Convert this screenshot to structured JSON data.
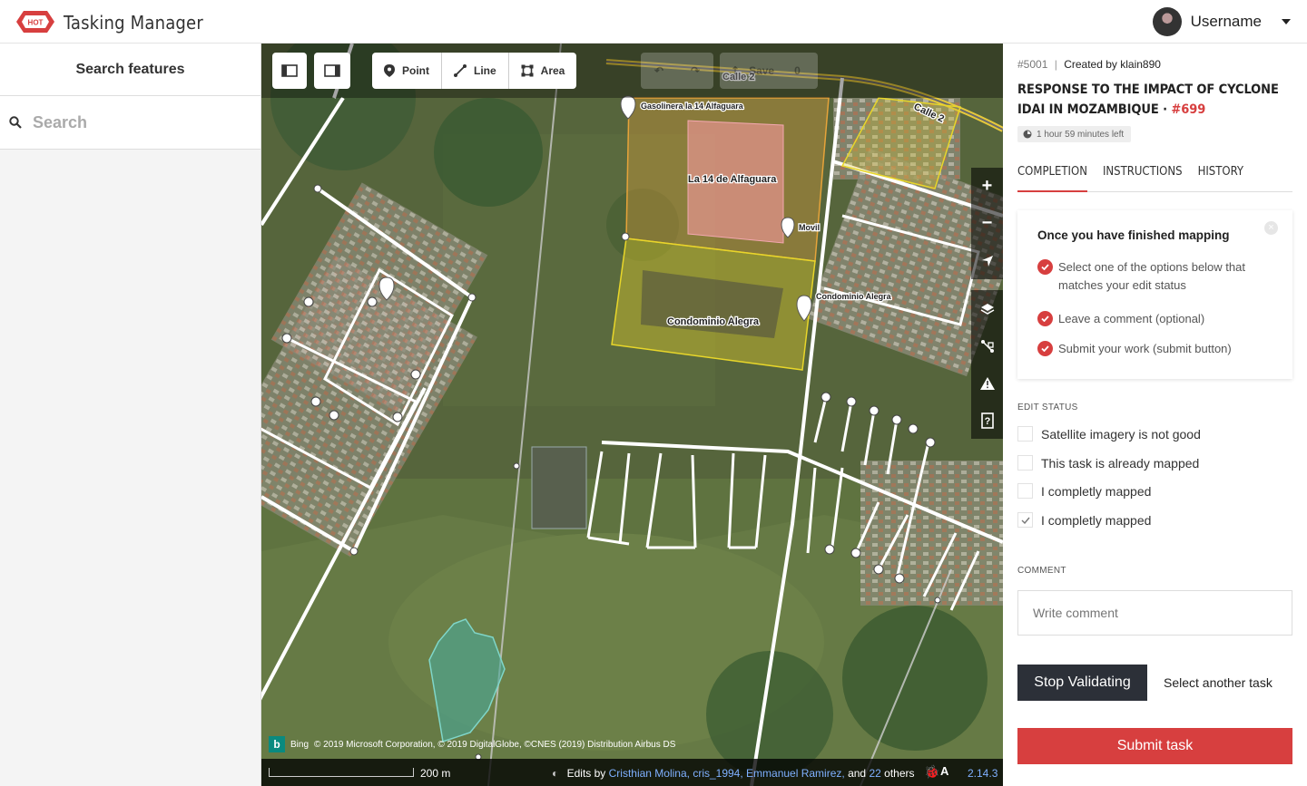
{
  "header": {
    "logo_text": "HOT",
    "brand": "Tasking Manager",
    "username": "Username",
    "avatar_icon": "avatar",
    "menu_icon": "chevron-down-icon",
    "accent": "#d73f3f"
  },
  "left_panel": {
    "title": "Search features",
    "search_placeholder": "Search",
    "search_icon": "search-icon"
  },
  "map": {
    "toolbar": {
      "sidebar_toggle_left_icon": "panel-left-icon",
      "sidebar_toggle_right_icon": "panel-right-icon",
      "modes": [
        {
          "label": "Point",
          "icon": "point-marker-icon"
        },
        {
          "label": "Line",
          "icon": "line-icon"
        },
        {
          "label": "Area",
          "icon": "area-icon"
        }
      ],
      "undo_icon": "undo-icon",
      "redo_icon": "redo-icon",
      "save_label": "Save",
      "save_count": "0"
    },
    "side_controls": [
      "zoom-in-icon",
      "zoom-out-icon",
      "geolocate-icon",
      "layers-icon",
      "map-data-icon",
      "issues-icon",
      "help-icon"
    ],
    "labels": {
      "gas_station": "Gasolinera la 14 Alfaguara",
      "store": "La 14 de Alfaguara",
      "movil": "Movil",
      "condo": "Condominio Alegra",
      "condo_pin": "Condominio Alegra",
      "street": "Calle 2",
      "street_under_save": "Calle 2"
    },
    "attribution": {
      "bing_label": "Bing",
      "text": "© 2019 Microsoft Corporation, © 2019 DigitalGlobe, ©CNES (2019) Distribution Airbus DS"
    },
    "footer": {
      "scale": "200 m",
      "edits_prefix": "Edits by",
      "editors": "Cristhian Molina, cris_1994, Emmanuel Ramirez,",
      "and": "and",
      "others_count": "22",
      "others": "others",
      "version": "2.14.3"
    }
  },
  "task": {
    "id": "#5001",
    "created_by_label": "Created by",
    "author": "klain890",
    "title": "Response to the impact of cyclone Idai in Mozambique",
    "separator": " · ",
    "project_id": "#699",
    "time_left": "1 hour 59 minutes left",
    "tabs": [
      "Completion",
      "Instructions",
      "History"
    ],
    "active_tab": 0,
    "card": {
      "heading": "Once you have finished mapping",
      "steps": [
        "Select one of the options below that matches your edit status",
        "Leave a comment (optional)",
        "Submit your work (submit button)"
      ]
    },
    "edit_status_label": "EDIT STATUS",
    "options": [
      {
        "label": "Satellite imagery is not good",
        "checked": false
      },
      {
        "label": "This task is already mapped",
        "checked": false
      },
      {
        "label": "I completly mapped",
        "checked": false
      },
      {
        "label": "I completly mapped",
        "checked": true
      }
    ],
    "comment_label": "COMMENT",
    "comment_placeholder": "Write comment",
    "stop_button": "Stop Validating",
    "select_another": "Select another task",
    "submit_button": "Submit task"
  }
}
